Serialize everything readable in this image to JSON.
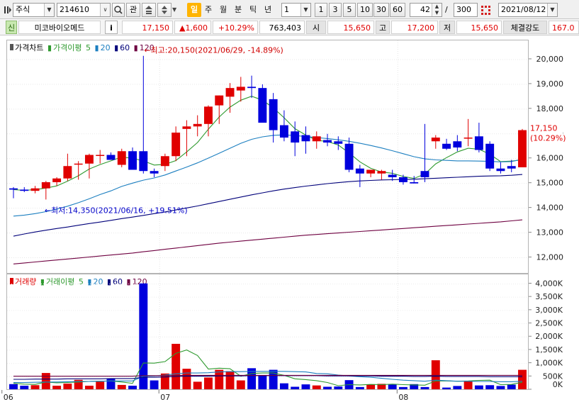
{
  "toolbar": {
    "market": "주식",
    "code": "214610",
    "icon_names": [
      "chart-menu-icon",
      "dropdown-icon",
      "search-icon",
      "favorites-icon",
      "stock-list-icon",
      "updown-stepper-icon",
      "grid-settings-icon",
      "calendar-icon"
    ],
    "fav_label": "관",
    "periods": [
      {
        "label": "일",
        "active": true
      },
      {
        "label": "주",
        "active": false
      },
      {
        "label": "월",
        "active": false
      },
      {
        "label": "분",
        "active": false
      },
      {
        "label": "틱",
        "active": false
      },
      {
        "label": "년",
        "active": false
      }
    ],
    "interval": "1",
    "interval_buttons": [
      "1",
      "3",
      "5",
      "10",
      "30",
      "60"
    ],
    "view_count": "42",
    "separator": "/",
    "total_count": "300",
    "date": "2021/08/12"
  },
  "quote": {
    "flag": "신",
    "name": "미코바이오메드",
    "info_button": "i",
    "price": "17,150",
    "change": "▲1,600",
    "rate": "+10.29%",
    "volume": "763,403",
    "open_label": "시",
    "open": "15,650",
    "high_label": "고",
    "high": "17,200",
    "low_label": "저",
    "low": "15,650",
    "strength_label": "체결강도",
    "strength": "167.0"
  },
  "price_chart": {
    "legend": {
      "title": "가격차트",
      "ma_label": "가격이평",
      "ma": [
        "5",
        "20",
        "60",
        "120"
      ]
    },
    "max_annotation": "←최고:20,150(2021/06/29, -14.89%)",
    "min_annotation": "←최저:14,350(2021/06/16, +19.51%)",
    "last_price_label": "17,150",
    "last_rate_label": "(10.29%)",
    "y_ticks": [
      "20,000",
      "19,000",
      "18,000",
      "17,000",
      "16,000",
      "15,000",
      "14,000",
      "13,000",
      "12,000"
    ],
    "colors": {
      "up": "#e00000",
      "down": "#0000dd",
      "ma5": "#2f9a2f",
      "ma20": "#1c7fc0",
      "ma60": "#00007a",
      "ma120": "#6e0040"
    }
  },
  "volume_chart": {
    "legend": {
      "title": "거래량",
      "ma_label": "거래이평",
      "ma": [
        "5",
        "20",
        "60",
        "120"
      ]
    },
    "y_ticks": [
      "4,000K",
      "3,500K",
      "3,000K",
      "2,500K",
      "2,000K",
      "1,500K",
      "1,000K",
      "500K",
      "0K"
    ]
  },
  "x_axis": {
    "labels": [
      "06",
      "07",
      "08"
    ]
  },
  "chart_data": {
    "type": "candlestick",
    "x": [
      "2021/06/11",
      "2021/06/14",
      "2021/06/15",
      "2021/06/16",
      "2021/06/17",
      "2021/06/18",
      "2021/06/21",
      "2021/06/22",
      "2021/06/23",
      "2021/06/24",
      "2021/06/25",
      "2021/06/28",
      "2021/06/29",
      "2021/06/30",
      "2021/07/01",
      "2021/07/02",
      "2021/07/05",
      "2021/07/06",
      "2021/07/07",
      "2021/07/08",
      "2021/07/09",
      "2021/07/12",
      "2021/07/13",
      "2021/07/14",
      "2021/07/15",
      "2021/07/16",
      "2021/07/19",
      "2021/07/20",
      "2021/07/21",
      "2021/07/22",
      "2021/07/23",
      "2021/07/26",
      "2021/07/27",
      "2021/07/28",
      "2021/07/29",
      "2021/07/30",
      "2021/08/02",
      "2021/08/03",
      "2021/08/04",
      "2021/08/05",
      "2021/08/06",
      "2021/08/09",
      "2021/08/10",
      "2021/08/11",
      "2021/08/12"
    ],
    "open": [
      14800,
      14750,
      14700,
      14800,
      15050,
      15200,
      15800,
      15800,
      16150,
      16150,
      15750,
      16300,
      16300,
      15500,
      15700,
      16100,
      17200,
      17300,
      17400,
      18150,
      18500,
      18750,
      18900,
      18850,
      18400,
      17350,
      17100,
      16950,
      16700,
      16750,
      16700,
      16600,
      15600,
      15400,
      15400,
      15350,
      15250,
      15050,
      15500,
      16700,
      16600,
      16700,
      16850,
      16900,
      16600,
      15600,
      15700,
      15650
    ],
    "high": [
      14850,
      14850,
      14900,
      15100,
      15250,
      16200,
      15900,
      16200,
      16350,
      16250,
      16400,
      16450,
      20150,
      15600,
      16200,
      17300,
      17550,
      17750,
      18150,
      18550,
      19050,
      19300,
      19350,
      19000,
      18650,
      17950,
      17500,
      17300,
      17100,
      17000,
      16900,
      16850,
      15750,
      15500,
      15550,
      15550,
      15350,
      15300,
      17400,
      16950,
      16800,
      16950,
      17600,
      17450,
      16700,
      15850,
      15950,
      17200
    ],
    "low": [
      14400,
      14650,
      14600,
      14350,
      14900,
      15100,
      15150,
      15200,
      15800,
      15950,
      15650,
      15900,
      15400,
      15250,
      15500,
      15900,
      16100,
      16900,
      16900,
      17400,
      17850,
      18300,
      18450,
      18700,
      16650,
      16700,
      16100,
      16200,
      16400,
      16500,
      16350,
      15450,
      14850,
      15250,
      15150,
      15100,
      14950,
      15000,
      15050,
      16400,
      16350,
      16300,
      16500,
      16250,
      15500,
      15400,
      15450,
      15650
    ],
    "close": [
      14750,
      14700,
      14800,
      15050,
      15200,
      15700,
      15800,
      16150,
      16150,
      15950,
      16300,
      15550,
      15500,
      15400,
      16100,
      17050,
      17300,
      17400,
      18100,
      18550,
      18850,
      18900,
      18850,
      17450,
      17150,
      16850,
      16650,
      16700,
      16900,
      16650,
      16600,
      15550,
      15400,
      15550,
      15500,
      15250,
      15050,
      15000,
      15250,
      16850,
      16400,
      16450,
      16850,
      16350,
      15600,
      15500,
      15600,
      17150
    ],
    "series": [
      {
        "name": "5",
        "values": [
          14750,
          14720,
          14750,
          14810,
          14900,
          15090,
          15310,
          15580,
          15760,
          15910,
          16070,
          16010,
          15910,
          15740,
          15770,
          15920,
          16270,
          16650,
          17190,
          17680,
          18080,
          18360,
          18520,
          18360,
          18050,
          17650,
          17210,
          16950,
          16740,
          16690,
          16550,
          16230,
          15870,
          15610,
          15460,
          15410,
          15280,
          15200,
          15380,
          15790,
          16040,
          16270,
          16420,
          16380,
          16180,
          15880,
          15900,
          15950
        ]
      },
      {
        "name": "20",
        "values": [
          13680,
          13720,
          13780,
          13860,
          13960,
          14080,
          14220,
          14380,
          14550,
          14700,
          14880,
          15010,
          15130,
          15220,
          15340,
          15500,
          15660,
          15830,
          16020,
          16220,
          16420,
          16620,
          16780,
          16880,
          16940,
          16960,
          16930,
          16890,
          16850,
          16810,
          16760,
          16700,
          16620,
          16530,
          16430,
          16320,
          16200,
          16080,
          15990,
          15950,
          15930,
          15910,
          15910,
          15900,
          15890,
          15870,
          15880,
          15980
        ]
      },
      {
        "name": "60",
        "values": [
          12870,
          12960,
          13040,
          13110,
          13180,
          13240,
          13310,
          13380,
          13440,
          13510,
          13580,
          13640,
          13710,
          13780,
          13850,
          13930,
          14010,
          14090,
          14180,
          14270,
          14360,
          14450,
          14540,
          14620,
          14700,
          14770,
          14830,
          14890,
          14940,
          14990,
          15030,
          15070,
          15100,
          15120,
          15140,
          15150,
          15160,
          15170,
          15190,
          15210,
          15230,
          15250,
          15270,
          15290,
          15300,
          15310,
          15330,
          15360
        ]
      },
      {
        "name": "120",
        "values": [
          11750,
          11790,
          11830,
          11870,
          11910,
          11950,
          11990,
          12030,
          12070,
          12110,
          12150,
          12190,
          12240,
          12290,
          12340,
          12390,
          12440,
          12490,
          12540,
          12590,
          12630,
          12670,
          12710,
          12750,
          12790,
          12830,
          12870,
          12910,
          12940,
          12970,
          13000,
          13030,
          13060,
          13090,
          13120,
          13150,
          13180,
          13210,
          13240,
          13270,
          13300,
          13330,
          13360,
          13390,
          13420,
          13450,
          13490,
          13530
        ]
      }
    ],
    "volume": [
      220,
      160,
      180,
      640,
      160,
      240,
      380,
      160,
      310,
      430,
      190,
      160,
      4020,
      360,
      620,
      1740,
      800,
      310,
      470,
      760,
      710,
      360,
      820,
      560,
      760,
      250,
      120,
      210,
      170,
      120,
      130,
      370,
      110,
      210,
      230,
      200,
      110,
      220,
      110,
      1120,
      90,
      150,
      340,
      170,
      180,
      150,
      200,
      760
    ],
    "volume_units": "K",
    "volume_ma": [
      {
        "name": "5",
        "values": [
          250,
          220,
          210,
          300,
          270,
          280,
          300,
          320,
          330,
          340,
          300,
          250,
          1020,
          1010,
          1070,
          1380,
          1510,
          1300,
          790,
          820,
          800,
          520,
          620,
          640,
          640,
          550,
          420,
          390,
          350,
          280,
          160,
          200,
          190,
          210,
          200,
          220,
          200,
          190,
          180,
          340,
          340,
          330,
          340,
          360,
          370,
          200,
          210,
          290
        ]
      },
      {
        "name": "20",
        "values": [
          280,
          280,
          290,
          300,
          300,
          310,
          320,
          320,
          330,
          340,
          340,
          340,
          520,
          530,
          560,
          610,
          640,
          640,
          650,
          680,
          690,
          690,
          700,
          700,
          700,
          700,
          690,
          680,
          620,
          610,
          560,
          530,
          500,
          480,
          440,
          400,
          370,
          350,
          330,
          370,
          350,
          330,
          330,
          320,
          320,
          310,
          310,
          330
        ]
      },
      {
        "name": "60",
        "values": [
          400,
          400,
          410,
          410,
          410,
          420,
          420,
          420,
          420,
          430,
          430,
          430,
          480,
          480,
          490,
          510,
          520,
          520,
          520,
          530,
          530,
          530,
          540,
          540,
          540,
          540,
          540,
          540,
          540,
          530,
          530,
          530,
          530,
          530,
          520,
          520,
          520,
          510,
          510,
          520,
          510,
          510,
          510,
          510,
          500,
          500,
          500,
          500
        ]
      },
      {
        "name": "120",
        "values": [
          520,
          520,
          520,
          520,
          520,
          520,
          520,
          520,
          520,
          520,
          520,
          520,
          540,
          540,
          540,
          550,
          550,
          550,
          550,
          550,
          550,
          550,
          550,
          550,
          550,
          550,
          550,
          550,
          550,
          550,
          550,
          550,
          550,
          550,
          550,
          550,
          550,
          550,
          550,
          550,
          550,
          550,
          550,
          550,
          550,
          550,
          550,
          550
        ]
      }
    ],
    "ylim": [
      11500,
      20600
    ],
    "volume_ylim": [
      0,
      4200
    ]
  }
}
